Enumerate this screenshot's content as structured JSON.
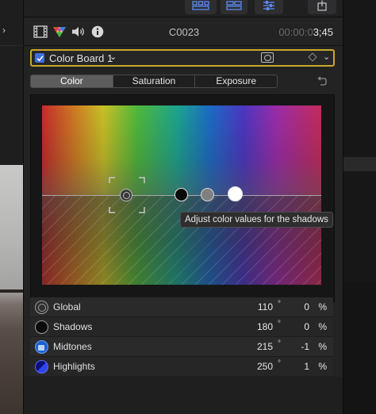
{
  "left_pane": {
    "chevron": "›"
  },
  "inspector": {
    "clip_name": "C0023",
    "timecode_dim": "00:00:0",
    "timecode_bright": "3;45",
    "effect": {
      "enabled": true,
      "name": "Color Board 1",
      "name_chevron": "⌄",
      "menu_chevron": "⌄"
    },
    "tabs": [
      {
        "label": "Color",
        "active": true
      },
      {
        "label": "Saturation",
        "active": false
      },
      {
        "label": "Exposure",
        "active": false
      }
    ],
    "tooltip": "Adjust color values for the shadows",
    "parameters": [
      {
        "label": "Global",
        "angle": "110",
        "degree_mark": "°",
        "percent": "0",
        "percent_sign": "%",
        "icon": "global-puck-icon"
      },
      {
        "label": "Shadows",
        "angle": "180",
        "degree_mark": "°",
        "percent": "0",
        "percent_sign": "%",
        "icon": "shadows-puck-icon"
      },
      {
        "label": "Midtones",
        "angle": "215",
        "degree_mark": "°",
        "percent": "-1",
        "percent_sign": "%",
        "icon": "midtones-puck-icon"
      },
      {
        "label": "Highlights",
        "angle": "250",
        "degree_mark": "°",
        "percent": "1",
        "percent_sign": "%",
        "icon": "highlights-puck-icon"
      }
    ]
  },
  "colors": {
    "focus_border": "#c9a72b",
    "checkbox_blue": "#3d6fe0",
    "active_tab": "#5d5d5d"
  }
}
